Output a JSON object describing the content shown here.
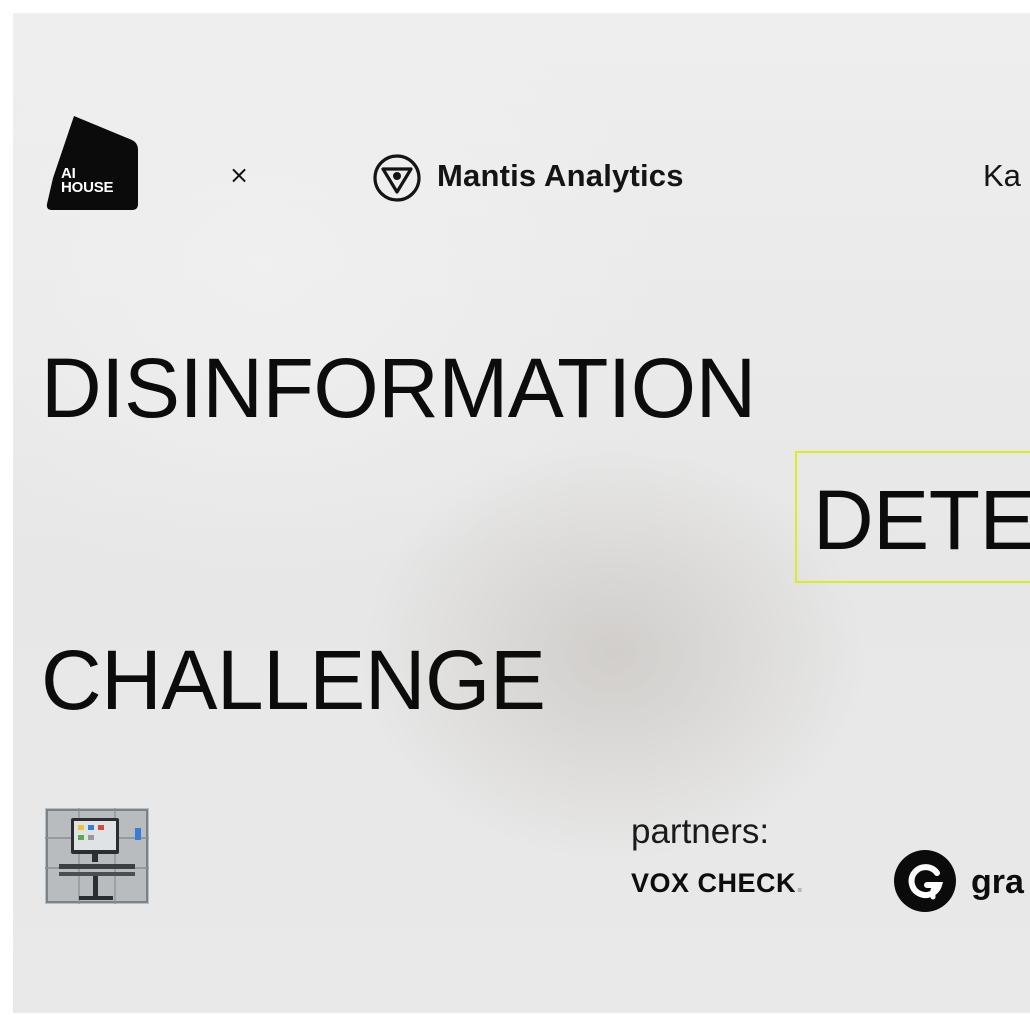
{
  "header": {
    "ai_house_logo": {
      "line1": "AI",
      "line2": "HOUSE"
    },
    "separator": "×",
    "mantis": {
      "name": "Mantis Analytics",
      "icon": "mantis-triangle-icon"
    },
    "kanal_partial": "Ka"
  },
  "headline": {
    "line1": "DISINFORMATION",
    "line2": "DETE",
    "line3": "CHALLENGE"
  },
  "colors": {
    "accent_frame": "#d9ec2a",
    "text": "#0d0d0d",
    "background": "#e9e9e9"
  },
  "thumbnail": {
    "icon": "computer-desk-image"
  },
  "partners": {
    "label": "partners:",
    "voxcheck": "VOX CHECK",
    "voxcheck_dot": ".",
    "grammarly_partial": "gra",
    "grammarly_icon": "grammarly-g-icon"
  }
}
